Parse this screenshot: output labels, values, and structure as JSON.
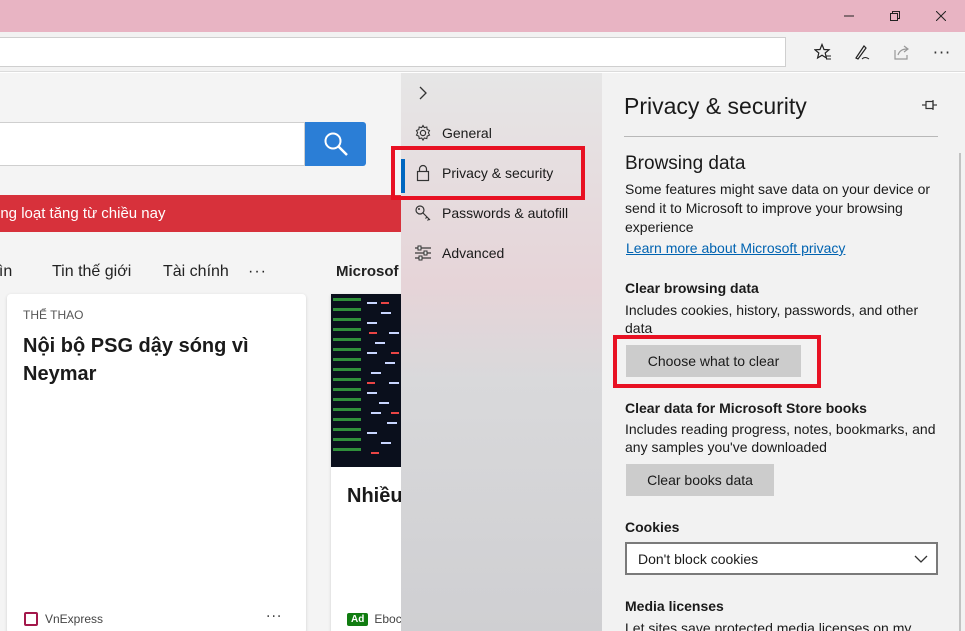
{
  "window": {
    "minimize_label": "–",
    "maximize_label": "◻",
    "close_label": "✕"
  },
  "toolbar": {
    "favorites_icon": "favorites-star-icon",
    "notes_icon": "pen-icon",
    "share_icon": "share-icon",
    "more_label": "···"
  },
  "page": {
    "breaking_news": "ồng loạt tăng từ chiều nay",
    "tabs": [
      "hìn",
      "Tin thế giới",
      "Tài chính",
      "···"
    ],
    "section_label": "Microsof",
    "card1": {
      "category": "THỂ THAO",
      "headline": "Nội bộ PSG dậy sóng vì Neymar",
      "source": "VnExpress",
      "more": "···"
    },
    "card2": {
      "headline": "Nhiều công n miễn p",
      "ad_badge": "Ad",
      "source": "Eboc"
    }
  },
  "nav": {
    "items": [
      {
        "label": "General",
        "icon": "gear-icon"
      },
      {
        "label": "Privacy & security",
        "icon": "lock-icon"
      },
      {
        "label": "Passwords & autofill",
        "icon": "key-icon"
      },
      {
        "label": "Advanced",
        "icon": "sliders-icon"
      }
    ],
    "selected": "Privacy & security"
  },
  "panel": {
    "title": "Privacy & security",
    "browsing_data": {
      "heading": "Browsing data",
      "description": "Some features might save data on your device or send it to Microsoft to improve your browsing experience",
      "link": "Learn more about Microsoft privacy"
    },
    "clear_browsing": {
      "heading": "Clear browsing data",
      "description": "Includes cookies, history, passwords, and other data",
      "button": "Choose what to clear"
    },
    "store_books": {
      "heading": "Clear data for Microsoft Store books",
      "description": "Includes reading progress, notes, bookmarks, and any samples you've downloaded",
      "button": "Clear books data"
    },
    "cookies": {
      "heading": "Cookies",
      "selected": "Don't block cookies"
    },
    "media": {
      "heading": "Media licenses",
      "description": "Let sites save protected media licenses on my"
    }
  },
  "colors": {
    "titlebar": "#e8b4c3",
    "accent": "#0067c0",
    "highlight": "#e81123",
    "breaking": "#d7313b",
    "search_button": "#2b7ed6"
  }
}
